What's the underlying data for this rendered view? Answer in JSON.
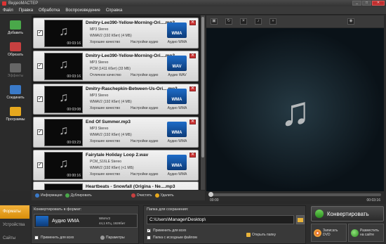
{
  "window": {
    "title": "ВидеоМАСТЕР",
    "min": "_",
    "max": "□",
    "close": "✕"
  },
  "menu": [
    "Файл",
    "Правка",
    "Обработка",
    "Воспроизведение",
    "Справка"
  ],
  "sidebar": [
    {
      "label": "Добавить",
      "color": "#4aa84a",
      "enabled": true
    },
    {
      "label": "Обрезать",
      "color": "#c84040",
      "enabled": true
    },
    {
      "label": "Эффекты",
      "color": "#666666",
      "enabled": false
    },
    {
      "label": "Соединить",
      "color": "#3a7ac8",
      "enabled": true
    },
    {
      "label": "Программы",
      "color": "#e6a81e",
      "enabled": true
    }
  ],
  "files": [
    {
      "name": "Dmitry-Lee390-Yellow-Morning-Ori....mp3",
      "audio": "MP3 Stereo",
      "codec": "WMAV2 (192 Кбит) (4 МБ)",
      "quality": "Хорошее качество",
      "settings": "Настройки аудио",
      "duration": "00:03:16",
      "format_badge": "WMA",
      "format_name": "Аудио WMA"
    },
    {
      "name": "Dmitry-Lee390-Yellow-Morning-Ori....mp3",
      "audio": "MP3 Stereo",
      "codec": "PCM (1411 Кбит) (33 МБ)",
      "quality": "Отличное качество",
      "settings": "Настройки аудио",
      "duration": "00:03:16",
      "format_badge": "WAV",
      "format_name": "Аудио WAV"
    },
    {
      "name": "Dmitry-Raschepkin-Between-Us-Ori....mp3",
      "audio": "MP3 Stereo",
      "codec": "WMAV2 (192 Кбит) (4 МБ)",
      "quality": "Хорошее качество",
      "settings": "Настройки аудио",
      "duration": "00:03:08",
      "format_badge": "WMA",
      "format_name": "Аудио WMA"
    },
    {
      "name": "End Of Summer.mp3",
      "audio": "MP3 Stereo",
      "codec": "WMAV2 (192 Кбит) (4 МБ)",
      "quality": "Хорошее качество",
      "settings": "Настройки аудио",
      "duration": "00:03:23",
      "format_badge": "WMA",
      "format_name": "Аудио WMA"
    },
    {
      "name": "Fairytale Holiday Loop 2.wav",
      "audio": "PCM_S16LE Stereo",
      "codec": "WMAV2 (192 Кбит) (<1 МБ)",
      "quality": "Хорошее качество",
      "settings": "Настройки аудио",
      "duration": "00:00:16",
      "format_badge": "WMA",
      "format_name": "Аудио WMA"
    },
    {
      "name": "Heartbeats - Snowfall (Origina - Ne....mp3",
      "audio": "",
      "codec": "",
      "quality": "",
      "settings": "",
      "duration": "",
      "format_badge": "",
      "format_name": ""
    }
  ],
  "listtools": {
    "info": "Информация",
    "duplicate": "Дублировать",
    "clear": "Очистить",
    "delete": "Удалить"
  },
  "player": {
    "time_start": "00:00",
    "time_end": "00:03:16",
    "progress": 0,
    "volume": 0.6
  },
  "tabs": [
    "Форматы",
    "Устройства",
    "Сайты"
  ],
  "convert": {
    "label": "Конвертировать в формат:",
    "format": "Аудио WMA",
    "details1": "WMAV2",
    "details2": "44,1 КГц, 192Кбит",
    "apply_all": "Применить для всех",
    "params": "Параметры"
  },
  "save": {
    "label": "Папка для сохранения:",
    "path": "C:\\Users\\Manager\\Desktop\\",
    "apply_all": "Применить для всех",
    "source_folder": "Папка с исходным файлом",
    "open_folder": "Открыть папку"
  },
  "actions": {
    "convert": "Конвертировать",
    "dvd1": "Записать",
    "dvd2": "DVD",
    "web1": "Разместить",
    "web2": "на сайте"
  }
}
